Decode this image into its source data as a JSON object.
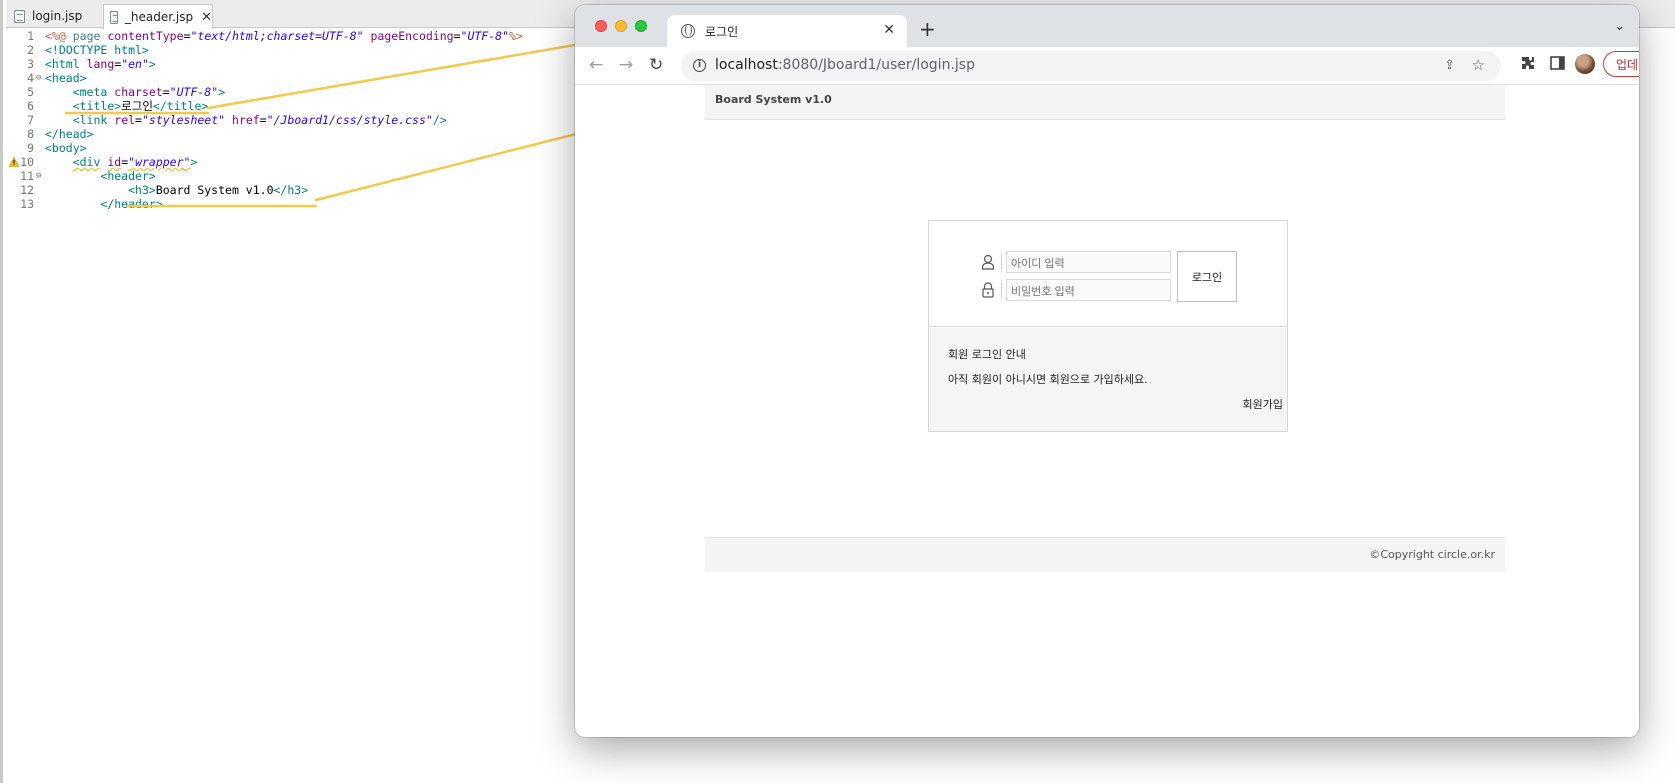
{
  "editor": {
    "tabs": [
      {
        "label": "login.jsp"
      },
      {
        "label": "_header.jsp",
        "close": "✕"
      }
    ],
    "lines": [
      {
        "n": "1",
        "html": "<span class='d'>&lt;%@</span> <span class='k'>page</span> <span class='a'>contentType</span>=<span class='v'>\"text/html;charset=UTF-8\"</span> <span class='a'>pageEncoding</span>=<span class='v'>\"UTF-8\"</span><span class='d'>%&gt;</span>"
      },
      {
        "n": "2",
        "html": "<span class='p'>&lt;!DOCTYPE html&gt;</span>"
      },
      {
        "n": "3",
        "html": "<span class='p'>&lt;html</span> <span class='a'>lang</span>=<span class='v'>\"en\"</span><span class='p'>&gt;</span>"
      },
      {
        "n": "4",
        "fold": true,
        "html": "<span class='p'>&lt;head&gt;</span>"
      },
      {
        "n": "5",
        "html": "    <span class='p'>&lt;meta</span> <span class='a'>charset</span>=<span class='v'>\"UTF-8\"</span><span class='p'>&gt;</span>"
      },
      {
        "n": "6",
        "html": "    <span class='p'>&lt;title&gt;</span><span class='t'>로그인</span><span class='p'>&lt;/title&gt;</span>"
      },
      {
        "n": "7",
        "html": "    <span class='p'>&lt;link</span> <span class='a'>rel</span>=<span class='v'>\"stylesheet\"</span> <span class='a'>href</span>=<span class='v'>\"/Jboard1/css/style.css\"</span><span class='p'>/&gt;</span>"
      },
      {
        "n": "8",
        "html": "<span class='p'>&lt;/head&gt;</span>"
      },
      {
        "n": "9",
        "html": "<span class='p'>&lt;body&gt;</span>"
      },
      {
        "n": "10",
        "warn": true,
        "html": "    <span class='p squig'>&lt;div</span> <span class='a squig'>id</span>=<span class='v squig'>\"wrapper\"</span><span class='p'>&gt;</span>"
      },
      {
        "n": "11",
        "fold": true,
        "html": "        <span class='p'>&lt;header&gt;</span>"
      },
      {
        "n": "12",
        "html": "            <span class='p'>&lt;h3&gt;</span><span class='t'>Board System v1.0</span><span class='p'>&lt;/h3&gt;</span>"
      },
      {
        "n": "13",
        "html": "        <span class='p'>&lt;/header&gt;</span>"
      }
    ]
  },
  "browser": {
    "tab_title": "로그인",
    "tab_close": "✕",
    "new_tab": "+",
    "tab_menu": "⌄",
    "url_host": "localhost",
    "url_rest": ":8080/Jboard1/user/login.jsp",
    "update_label": "업데이트",
    "update_dots": "⋮"
  },
  "page": {
    "header_title": "Board System v1.0",
    "id_placeholder": "아이디 입력",
    "pw_placeholder": "비밀번호 입력",
    "login_button": "로그인",
    "info_title": "회원 로그인 안내",
    "info_text": "아직 회원이 아니시면 회원으로 가입하세요.",
    "join_link": "회원가입",
    "footer": "©Copyright circle.or.kr"
  },
  "colors": {
    "annotation": "#f2c94c",
    "update_red": "#d23b3b"
  }
}
